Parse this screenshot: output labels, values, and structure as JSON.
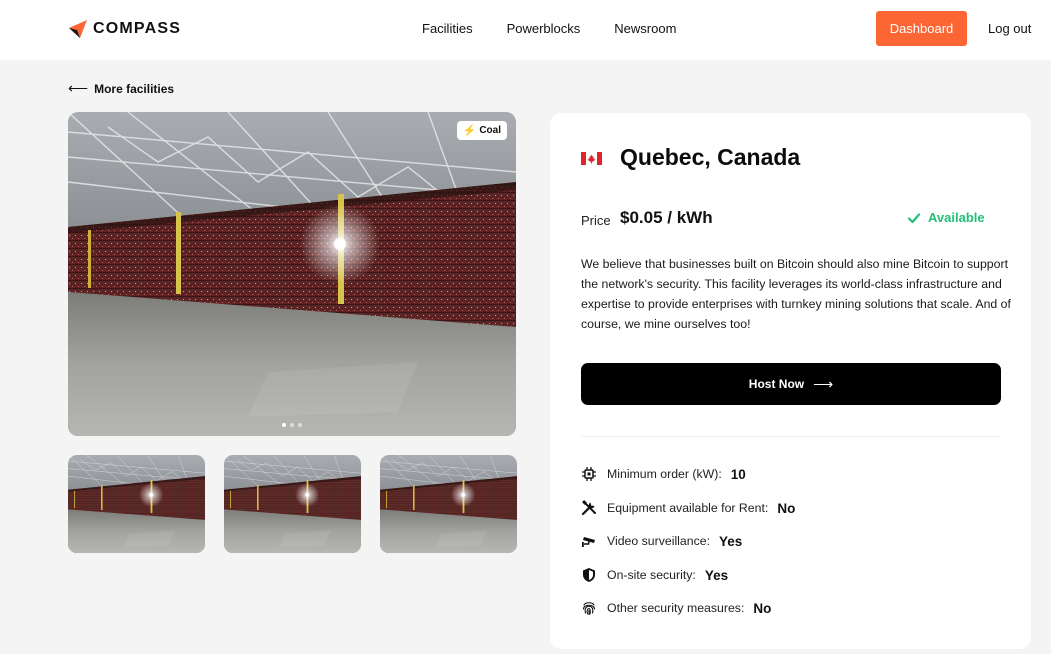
{
  "header": {
    "brand": "COMPASS",
    "nav": [
      "Facilities",
      "Powerblocks",
      "Newsroom"
    ],
    "dashboard_label": "Dashboard",
    "logout_label": "Log out"
  },
  "back_link": {
    "arrow": "⟵",
    "label": "More facilities"
  },
  "gallery": {
    "badge": "Coal",
    "dots": 3,
    "active_dot": 1,
    "thumbnail_count": 3
  },
  "facility": {
    "location": "Quebec, Canada",
    "price_label": "Price",
    "price": "$0.05 / kWh",
    "availability": "Available",
    "description": "We believe that businesses built on Bitcoin should also mine Bitcoin to support the network's security. This facility leverages its world-class infrastructure and expertise to provide enterprises with turnkey mining solutions that scale. And of course, we mine ourselves too!",
    "cta_label": "Host Now",
    "specs": [
      {
        "icon": "chip-icon",
        "label": "Minimum order (kW):",
        "value": "10"
      },
      {
        "icon": "tools-icon",
        "label": "Equipment available for Rent:",
        "value": "No"
      },
      {
        "icon": "camera-icon",
        "label": "Video surveillance:",
        "value": "Yes"
      },
      {
        "icon": "shield-icon",
        "label": "On-site security:",
        "value": "Yes"
      },
      {
        "icon": "fingerprint-icon",
        "label": "Other security measures:",
        "value": "No"
      }
    ]
  },
  "colors": {
    "accent": "#fc6634",
    "available": "#22c077",
    "background": "#f4f4f4",
    "cta": "#000000",
    "badge_bolt": "#f5a21b"
  }
}
